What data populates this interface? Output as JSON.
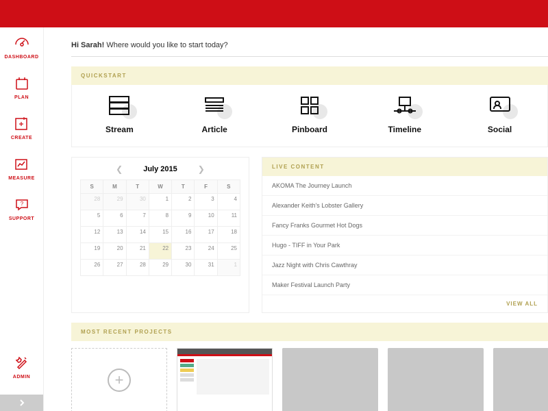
{
  "greeting": {
    "hello": "Hi Sarah!",
    "prompt": "Where would you like to start today?"
  },
  "sidebar": {
    "items": [
      {
        "label": "DASHBOARD"
      },
      {
        "label": "PLAN"
      },
      {
        "label": "CREATE"
      },
      {
        "label": "MEASURE"
      },
      {
        "label": "SUPPORT"
      },
      {
        "label": "ADMIN"
      }
    ]
  },
  "quickstart": {
    "title": "QUICKSTART",
    "items": [
      {
        "label": "Stream"
      },
      {
        "label": "Article"
      },
      {
        "label": "Pinboard"
      },
      {
        "label": "Timeline"
      },
      {
        "label": "Social"
      }
    ]
  },
  "calendar": {
    "title": "July 2015",
    "dow": [
      "S",
      "M",
      "T",
      "W",
      "T",
      "F",
      "S"
    ],
    "weeks": [
      [
        {
          "n": 28,
          "dim": true
        },
        {
          "n": 29,
          "dim": true
        },
        {
          "n": 30,
          "dim": true
        },
        {
          "n": 1
        },
        {
          "n": 2
        },
        {
          "n": 3
        },
        {
          "n": 4
        }
      ],
      [
        {
          "n": 5
        },
        {
          "n": 6
        },
        {
          "n": 7
        },
        {
          "n": 8
        },
        {
          "n": 9
        },
        {
          "n": 10
        },
        {
          "n": 11
        }
      ],
      [
        {
          "n": 12
        },
        {
          "n": 13
        },
        {
          "n": 14
        },
        {
          "n": 15
        },
        {
          "n": 16
        },
        {
          "n": 17
        },
        {
          "n": 18
        }
      ],
      [
        {
          "n": 19
        },
        {
          "n": 20
        },
        {
          "n": 21
        },
        {
          "n": 22,
          "hl": true
        },
        {
          "n": 23
        },
        {
          "n": 24
        },
        {
          "n": 25
        }
      ],
      [
        {
          "n": 26
        },
        {
          "n": 27
        },
        {
          "n": 28
        },
        {
          "n": 29
        },
        {
          "n": 30
        },
        {
          "n": 31
        },
        {
          "n": 1,
          "dim": true
        }
      ]
    ]
  },
  "live": {
    "title": "LIVE CONTENT",
    "items": [
      "AKOMA The Journey Launch",
      "Alexander Keith's Lobster Gallery",
      "Fancy Franks Gourmet Hot Dogs",
      "Hugo - TIFF in Your Park",
      "Jazz Night with Chris Cawthray",
      "Maker Festival Launch Party"
    ],
    "view_all": "VIEW ALL"
  },
  "recent": {
    "title": "MOST RECENT PROJECTS"
  }
}
